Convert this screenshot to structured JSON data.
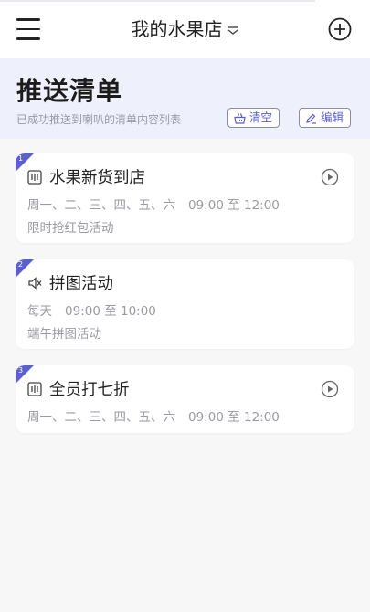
{
  "topbar": {
    "title": "我的水果店",
    "menu_icon": "menu-icon",
    "dropdown_icon": "chevron-down-icon",
    "add_icon": "add-circle-icon"
  },
  "header": {
    "title": "推送清单",
    "subtitle": "已成功推送到喇叭的清单内容列表",
    "clear_label": "清空",
    "edit_label": "编辑"
  },
  "colors": {
    "accent": "#5b5fd1",
    "header_bg": "#eef0fb",
    "muted_text": "#9a9aa2"
  },
  "items": [
    {
      "index": "1",
      "title": "水果新货到店",
      "days": "周一、二、三、四、五、六",
      "time": "09:00 至 12:00",
      "note": "限时抢红包活动",
      "icon": "audio-bars-icon",
      "has_play": true
    },
    {
      "index": "2",
      "title": "拼图活动",
      "days": "每天",
      "time": "09:00 至 10:00",
      "note": "端午拼图活动",
      "icon": "muted-speaker-icon",
      "has_play": false
    },
    {
      "index": "3",
      "title": "全员打七折",
      "days": "周一、二、三、四、五、六",
      "time": "09:00 至 12:00",
      "note": "",
      "icon": "audio-bars-icon",
      "has_play": true
    }
  ]
}
